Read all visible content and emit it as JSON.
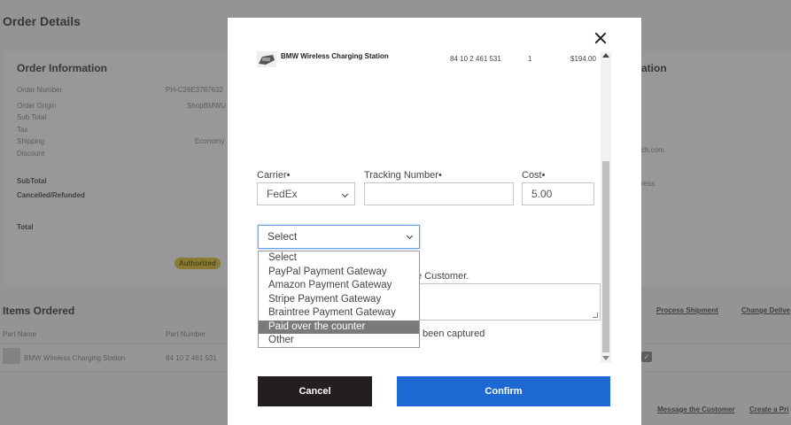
{
  "background": {
    "page_title": "Order Details",
    "order_info": {
      "heading": "Order Information",
      "rows": [
        {
          "label": "Order Number",
          "value": "PH-C26E3787632"
        },
        {
          "label": "Order Origin",
          "value": "ShopBMWU"
        },
        {
          "label": "Sub Total",
          "value": ""
        },
        {
          "label": "Tax",
          "value": ""
        },
        {
          "label": "Shipping",
          "value": "Economy"
        },
        {
          "label": "Discount",
          "value": ""
        }
      ],
      "subtotal_label": "SubTotal",
      "cancelled_label": "Cancelled/Refunded",
      "total_label": "Total",
      "status_badge": "Authorized"
    },
    "right_card": {
      "heading_fragment": "ation",
      "email_fragment": "ch.com",
      "address_fragment": "ress"
    },
    "items": {
      "heading": "Items Ordered",
      "col_part_name": "Part Name",
      "col_part_number": "Part Number",
      "row_name": "BMW Wireless Charging Station",
      "row_part_number": "84 10 2 461 531",
      "check_mark": "✓",
      "link_process_shipment": "Process Shipment",
      "link_change_delivery": "Change Delive",
      "link_message_customer": "Message the Customer",
      "link_create_print": "Create a Pri"
    }
  },
  "modal": {
    "close_label": "×",
    "product": {
      "name": "BMW Wireless Charging Station",
      "part_number": "84 10 2 461 531",
      "quantity": "1",
      "price": "$194.00"
    },
    "carrier": {
      "label": "Carrier•",
      "value": "FedEx"
    },
    "tracking": {
      "label": "Tracking Number•",
      "value": ""
    },
    "cost": {
      "label": "Cost•",
      "value": "5.00"
    },
    "payment": {
      "selected": "Select",
      "options": [
        "Select",
        "PayPal Payment Gateway",
        "Amazon Payment Gateway",
        "Stripe Payment Gateway",
        "Braintree Payment Gateway",
        "Paid over the counter",
        "Other"
      ],
      "highlighted_index": 5
    },
    "notify_text_fragment": "e Customer.",
    "captured_text_fragment": "been captured",
    "cancel_label": "Cancel",
    "confirm_label": "Confirm"
  },
  "colors": {
    "confirm_blue": "#1c69d4",
    "cancel_black": "#231f20",
    "badge_gold": "#c8b12a"
  }
}
